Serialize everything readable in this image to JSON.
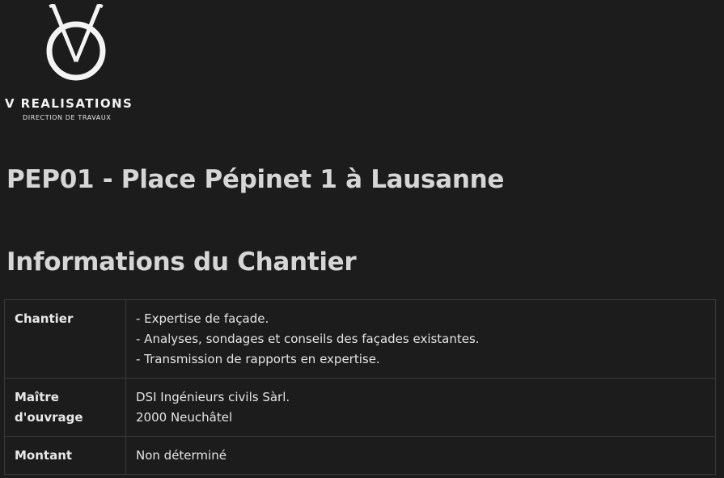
{
  "logo": {
    "title": "V REALISATIONS",
    "subtitle": "DIRECTION DE TRAVAUX",
    "icon": "v-compass-logo-icon"
  },
  "project": {
    "title": "PEP01 - Place Pépinet 1 à Lausanne"
  },
  "section": {
    "title": "Informations du Chantier"
  },
  "table": {
    "rows": [
      {
        "label": "Chantier",
        "lines": [
          "- Expertise de façade.",
          "- Analyses, sondages et conseils des façades existantes.",
          "- Transmission de rapports en expertise."
        ]
      },
      {
        "label_lines": [
          "Maître",
          "d'ouvrage"
        ],
        "lines": [
          "DSI Ingénieurs civils Sàrl.",
          "2000 Neuchâtel"
        ]
      },
      {
        "label": "Montant",
        "lines": [
          "Non déterminé"
        ]
      }
    ]
  },
  "colors": {
    "background": "#1c1c1c",
    "text": "#e6e6e6",
    "border": "#3a3a3a"
  }
}
